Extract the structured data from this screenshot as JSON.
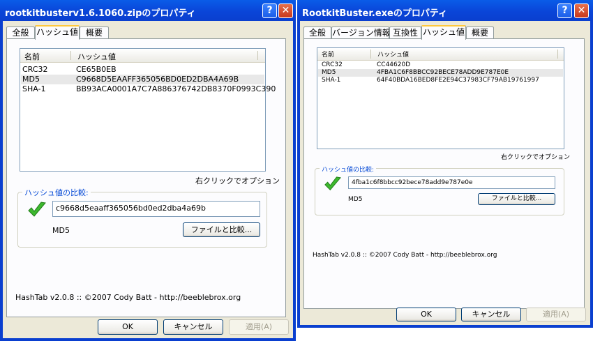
{
  "dialog1": {
    "title": "rootkitbusterv1.6.1060.zipのプロパティ",
    "tabs": [
      "全般",
      "ハッシュ値",
      "概要"
    ],
    "columns": {
      "name": "名前",
      "hash": "ハッシュ値"
    },
    "rows": [
      {
        "name": "CRC32",
        "value": "CE65B0EB"
      },
      {
        "name": "MD5",
        "value": "C9668D5EAAFF365056BD0ED2DBA4A69B"
      },
      {
        "name": "SHA-1",
        "value": "BB93ACA0001A7C7A886376742DB8370F0993C390"
      }
    ],
    "right_click_hint": "右クリックでオプション",
    "compare_title": "ハッシュ値の比較:",
    "compare_value": "c9668d5eaaff365056bd0ed2dba4a69b",
    "match_type": "MD5",
    "compare_button": "ファイルと比較...",
    "credit": "HashTab v2.0.8 :: ©2007 Cody Batt  -  http://beeblebrox.org",
    "ok": "OK",
    "cancel": "キャンセル",
    "apply": "適用(A)"
  },
  "dialog2": {
    "title": "RootkitBuster.exeのプロパティ",
    "tabs": [
      "全般",
      "バージョン情報",
      "互換性",
      "ハッシュ値",
      "概要"
    ],
    "columns": {
      "name": "名前",
      "hash": "ハッシュ値"
    },
    "rows": [
      {
        "name": "CRC32",
        "value": "CC44620D"
      },
      {
        "name": "MD5",
        "value": "4FBA1C6F8BBCC92BECE78ADD9E787E0E"
      },
      {
        "name": "SHA-1",
        "value": "64F40BDA16BED8FE2E94C37983CF79AB19761997"
      }
    ],
    "right_click_hint": "右クリックでオプション",
    "compare_title": "ハッシュ値の比較:",
    "compare_value": "4fba1c6f8bbcc92bece78add9e787e0e",
    "match_type": "MD5",
    "compare_button": "ファイルと比較...",
    "credit": "HashTab v2.0.8 :: ©2007 Cody Batt  -  http://beeblebrox.org",
    "ok": "OK",
    "cancel": "キャンセル",
    "apply": "適用(A)"
  }
}
